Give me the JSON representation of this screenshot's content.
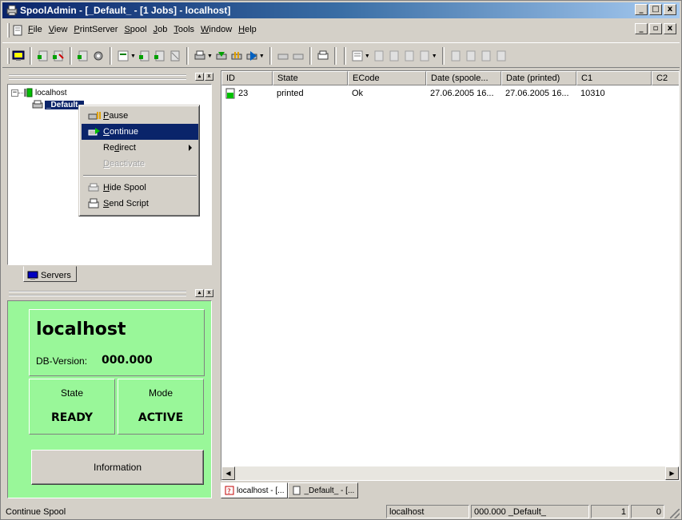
{
  "window": {
    "title": "SpoolAdmin - [_Default_ - [1 Jobs] - localhost]",
    "controls": {
      "minimize": "_",
      "maximize": "□",
      "close": "x"
    },
    "mdi_controls": {
      "minimize": "_",
      "restore": "▫",
      "close": "x"
    }
  },
  "menubar": {
    "items": [
      {
        "pre": "",
        "key": "F",
        "post": "ile"
      },
      {
        "pre": "",
        "key": "V",
        "post": "iew"
      },
      {
        "pre": "",
        "key": "P",
        "post": "rintServer"
      },
      {
        "pre": "",
        "key": "S",
        "post": "pool"
      },
      {
        "pre": "",
        "key": "J",
        "post": "ob"
      },
      {
        "pre": "",
        "key": "T",
        "post": "ools"
      },
      {
        "pre": "",
        "key": "W",
        "post": "indow"
      },
      {
        "pre": "",
        "key": "H",
        "post": "elp"
      }
    ]
  },
  "tree": {
    "root_label": "localhost",
    "root_expander": "−",
    "child_label": "_Default_"
  },
  "left_tabs": {
    "servers": "Servers"
  },
  "context_menu": {
    "pause": {
      "pre": "",
      "key": "P",
      "post": "ause"
    },
    "continue": {
      "pre": "",
      "key": "C",
      "post": "ontinue"
    },
    "redirect": {
      "pre": "Re",
      "key": "d",
      "post": "irect"
    },
    "deactivate": {
      "pre": "",
      "key": "D",
      "post": "eactivate"
    },
    "hide_spool": {
      "pre": "",
      "key": "H",
      "post": "ide Spool"
    },
    "send_script": {
      "pre": "",
      "key": "S",
      "post": "end Script"
    }
  },
  "info": {
    "host": "localhost",
    "db_version_label": "DB-Version:",
    "db_version": "000.000",
    "state_label": "State",
    "state": "READY",
    "mode_label": "Mode",
    "mode": "ACTIVE",
    "info_button": "Information",
    "bg_color": "#99f799"
  },
  "jobs": {
    "columns": [
      "ID",
      "State",
      "ECode",
      "Date (spoole...",
      "Date (printed)",
      "C1",
      "C2"
    ],
    "rows": [
      {
        "id": "23",
        "state": "printed",
        "ecode": "Ok",
        "date_spooled": "27.06.2005 16...",
        "date_printed": "27.06.2005 16...",
        "c1": "10310",
        "c2": ""
      }
    ]
  },
  "mdi_tabs": [
    {
      "label": "localhost - [..."
    },
    {
      "label": "_Default_ - [..."
    }
  ],
  "statusbar": {
    "message": "Continue Spool",
    "server": "localhost",
    "version_spool": "000.000 _Default_",
    "count1": "1",
    "count2": "0"
  },
  "colors": {
    "title_active": "#0a246a",
    "selection": "#0a246a",
    "info_green": "#99f799"
  }
}
